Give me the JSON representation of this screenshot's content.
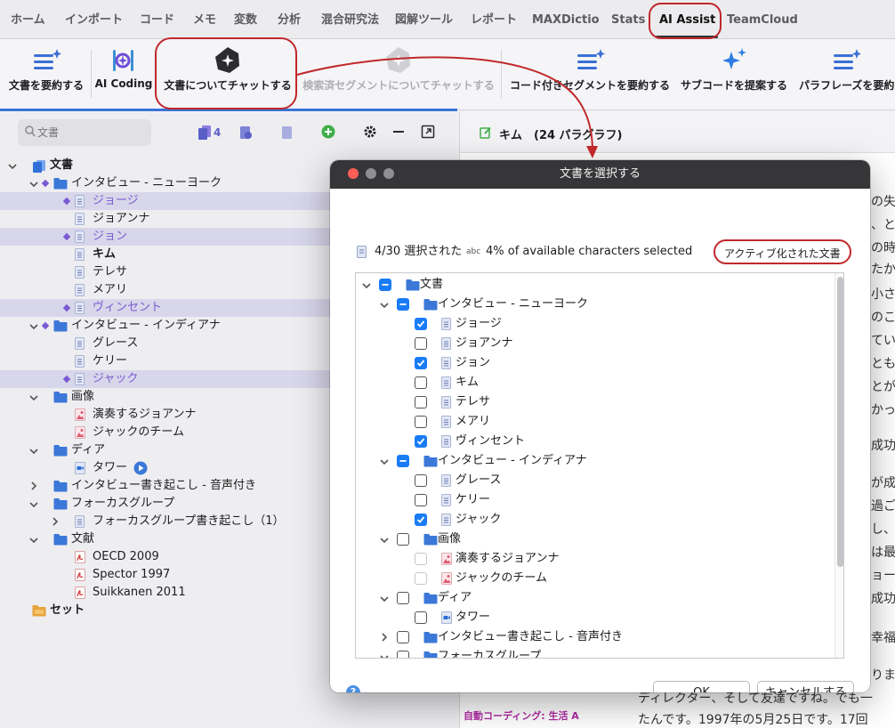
{
  "menubar": {
    "tabs": [
      {
        "label": "ホーム"
      },
      {
        "label": "インポート"
      },
      {
        "label": "コード"
      },
      {
        "label": "メモ"
      },
      {
        "label": "変数"
      },
      {
        "label": "分析"
      },
      {
        "label": "混合研究法"
      },
      {
        "label": "図解ツール"
      },
      {
        "label": "レポート"
      },
      {
        "label": "MAXDictio"
      },
      {
        "label": "Stats"
      },
      {
        "label": "AI Assist"
      },
      {
        "label": "TeamCloud"
      }
    ],
    "active": "AI Assist"
  },
  "ribbon": {
    "summarize_docs": "文書を要約する",
    "ai_coding": "AI Coding",
    "chat_docs": "文書についてチャットする",
    "chat_segments": "検索済セグメントについてチャットする",
    "summarize_coded": "コード付きセグメントを要約する",
    "suggest_subcodes": "サブコードを提案する",
    "paraphrase": "パラフレーズを要約"
  },
  "leftpanel": {
    "search_placeholder": "文書",
    "count": "4",
    "tree": [
      {
        "label": "文書"
      },
      {
        "label": "インタビュー - ニューヨーク"
      },
      {
        "label": "ジョージ"
      },
      {
        "label": "ジョアンナ"
      },
      {
        "label": "ジョン"
      },
      {
        "label": "キム"
      },
      {
        "label": "テレサ"
      },
      {
        "label": "メアリ"
      },
      {
        "label": "ヴィンセント"
      },
      {
        "label": "インタビュー - インディアナ"
      },
      {
        "label": "グレース"
      },
      {
        "label": "ケリー"
      },
      {
        "label": "ジャック"
      },
      {
        "label": "画像"
      },
      {
        "label": "演奏するジョアンナ"
      },
      {
        "label": "ジャックのチーム"
      },
      {
        "label": "ディア"
      },
      {
        "label": "タワー"
      },
      {
        "label": "インタビュー書き起こし - 音声付き"
      },
      {
        "label": "フォーカスグループ"
      },
      {
        "label": "フォーカスグループ書き起こし（1）"
      },
      {
        "label": "文献"
      },
      {
        "label": "OECD 2009"
      },
      {
        "label": "Spector 1997"
      },
      {
        "label": "Suikkanen 2011"
      },
      {
        "label": "セット"
      }
    ]
  },
  "rightpanel": {
    "title": "キム　(24 パラグラフ)",
    "fragments": [
      "の失",
      "、と",
      "の時",
      "たか",
      "小さ",
      "のこ",
      "てい",
      "とも",
      "とが",
      "かっ",
      "成功",
      "が成",
      "過ご",
      "し、",
      "は最",
      "ョー",
      "成功",
      "幸福",
      "りま"
    ],
    "line1": "ディレクター、そして友達ですね。でも一",
    "line2": "たんです。1997年の5月25日です。17回",
    "autocoding": "自動コーディング: 生活 A"
  },
  "dialog": {
    "title": "文書を選択する",
    "selected": "4/30 選択された",
    "chars_icon": "abc",
    "chars": "4% of available characters selected",
    "active_docs": "アクティブ化された文書",
    "tree": [
      {
        "label": "文書"
      },
      {
        "label": "インタビュー - ニューヨーク"
      },
      {
        "label": "ジョージ"
      },
      {
        "label": "ジョアンナ"
      },
      {
        "label": "ジョン"
      },
      {
        "label": "キム"
      },
      {
        "label": "テレサ"
      },
      {
        "label": "メアリ"
      },
      {
        "label": "ヴィンセント"
      },
      {
        "label": "インタビュー - インディアナ"
      },
      {
        "label": "グレース"
      },
      {
        "label": "ケリー"
      },
      {
        "label": "ジャック"
      },
      {
        "label": "画像"
      },
      {
        "label": "演奏するジョアンナ"
      },
      {
        "label": "ジャックのチーム"
      },
      {
        "label": "ディア"
      },
      {
        "label": "タワー"
      },
      {
        "label": "インタビュー書き起こし - 音声付き"
      },
      {
        "label": "フォーカスグループ"
      }
    ],
    "help": "?",
    "ok": "OK",
    "cancel": "キャンセルする"
  },
  "colors": {
    "accent": "#1a7cf5",
    "highlight": "#7a5ad1",
    "annotation": "#c0282c"
  }
}
